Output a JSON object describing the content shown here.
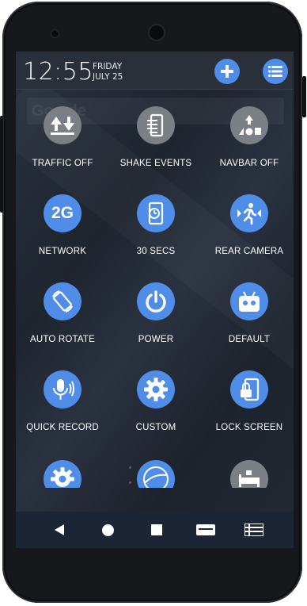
{
  "status": {
    "time": "12:55",
    "weekday": "FRIDAY",
    "date": "JULY 25",
    "add_icon": "plus-icon",
    "list_icon": "list-icon"
  },
  "background_search_hint": "Google",
  "colors": {
    "accent": "#4f8de8",
    "icon_gray": "#7b7f86",
    "screen_bg": "#232a34",
    "navbar_bg": "#1b2535"
  },
  "toggles": [
    {
      "label": "TRAFFIC OFF",
      "icon": "traffic-arrows-icon",
      "state": "off"
    },
    {
      "label": "SHAKE EVENTS",
      "icon": "shake-list-icon",
      "state": "off"
    },
    {
      "label": "NAVBAR OFF",
      "icon": "navbar-shapes-icon",
      "state": "off"
    },
    {
      "label": "NETWORK",
      "icon": "2g-network-icon",
      "badge": "2G",
      "state": "on"
    },
    {
      "label": "30 SECS",
      "icon": "screen-timeout-icon",
      "state": "on"
    },
    {
      "label": "REAR CAMERA",
      "icon": "running-person-camera-icon",
      "state": "on"
    },
    {
      "label": "AUTO ROTATE",
      "icon": "auto-rotate-icon",
      "state": "on"
    },
    {
      "label": "POWER",
      "icon": "power-icon",
      "state": "on"
    },
    {
      "label": "DEFAULT",
      "icon": "android-robot-icon",
      "state": "on"
    },
    {
      "label": "QUICK RECORD",
      "icon": "microphone-icon",
      "state": "on"
    },
    {
      "label": "CUSTOM",
      "icon": "gear-icon",
      "state": "on"
    },
    {
      "label": "LOCK SCREEN",
      "icon": "lock-screen-icon",
      "state": "on"
    }
  ],
  "partial_toggles": [
    {
      "icon": "settings-gear-icon",
      "state": "on"
    },
    {
      "icon": "ball-icon",
      "state": "on"
    },
    {
      "icon": "sleep-bed-icon",
      "state": "off"
    }
  ],
  "navbar": {
    "back_icon": "back-triangle-icon",
    "home_icon": "home-circle-icon",
    "recents_icon": "recents-square-icon",
    "menu_icon": "menu-bar-icon",
    "list_icon": "list-panel-icon"
  }
}
